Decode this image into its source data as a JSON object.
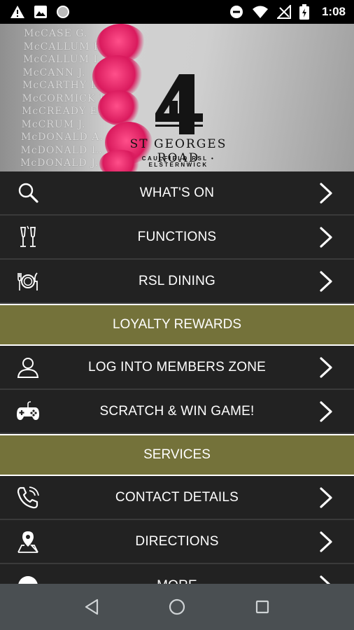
{
  "status_bar": {
    "time": "1:08",
    "left_icons": [
      "warning-icon",
      "image-icon",
      "circle-icon"
    ],
    "right_icons": [
      "do-not-disturb-icon",
      "wifi-icon",
      "no-signal-icon",
      "battery-icon"
    ]
  },
  "header": {
    "logo_title": "ST GEORGES ROAD",
    "logo_subtitle": "CAULFIELD RSL • ELSTERNWICK",
    "memorial_names": [
      "McCASE G.",
      "McCALLUM R.",
      "McCALLUM L.",
      "McCANN J.",
      "McCARTHY L.",
      "McCORMICK E.",
      "McCREADY E.",
      "McCRUM J.",
      "McDONALD A.",
      "McDONALD L.",
      "McDONALD J."
    ]
  },
  "menu": [
    {
      "type": "item",
      "label": "WHAT'S ON",
      "icon": "search-icon"
    },
    {
      "type": "item",
      "label": "FUNCTIONS",
      "icon": "champagne-glasses-icon"
    },
    {
      "type": "item",
      "label": "RSL DINING",
      "icon": "dining-icon"
    },
    {
      "type": "section",
      "label": "LOYALTY REWARDS"
    },
    {
      "type": "item",
      "label": "LOG INTO MEMBERS ZONE",
      "icon": "user-icon"
    },
    {
      "type": "item",
      "label": "SCRATCH & WIN GAME!",
      "icon": "gamepad-icon"
    },
    {
      "type": "section",
      "label": "SERVICES"
    },
    {
      "type": "item",
      "label": "CONTACT DETAILS",
      "icon": "phone-icon"
    },
    {
      "type": "item",
      "label": "DIRECTIONS",
      "icon": "map-pin-icon"
    },
    {
      "type": "item",
      "label": "MORE",
      "icon": "more-icon"
    }
  ],
  "colors": {
    "row_bg": "#222222",
    "section_bg": "#74723a",
    "navbar_bg": "#4a4f52"
  },
  "nav_bar": [
    "back-icon",
    "home-icon",
    "recents-icon"
  ]
}
